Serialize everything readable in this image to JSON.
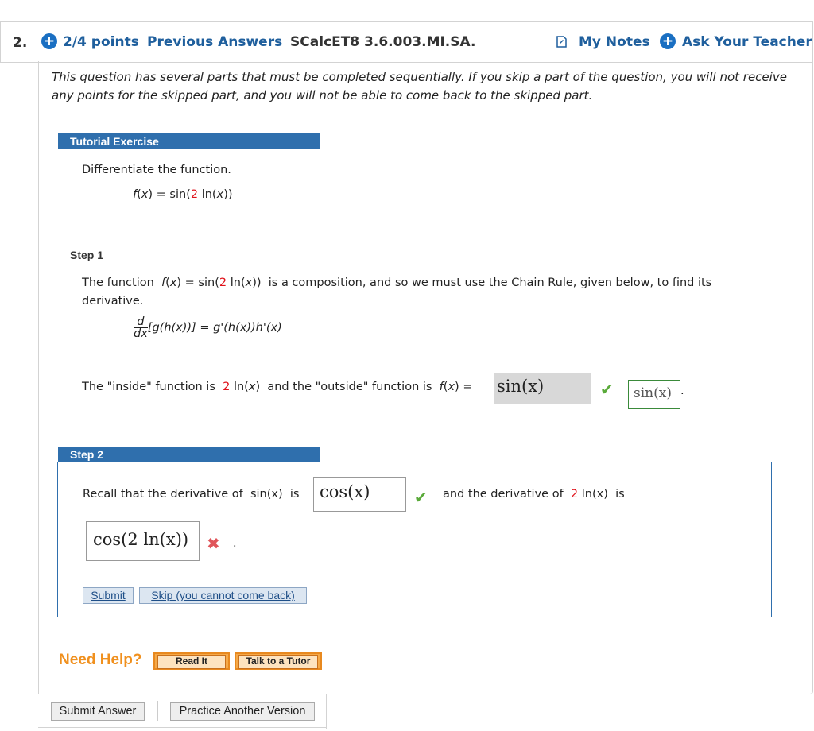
{
  "header": {
    "question_number": "2.",
    "points": "2/4 points",
    "previous_answers": "Previous Answers",
    "assignment_id": "SCalcET8 3.6.003.MI.SA.",
    "my_notes": "My Notes",
    "ask_teacher": "Ask Your Teacher"
  },
  "notice": "This question has several parts that must be completed sequentially. If you skip a part of the question, you will not receive any points for the skipped part, and you will not be able to come back to the skipped part.",
  "tutorial": {
    "title": "Tutorial Exercise",
    "instruction": "Differentiate the function.",
    "f": "f",
    "x": "x",
    "eq": "= sin(",
    "coef": "2",
    "ln": " ln(",
    "close": "))"
  },
  "step1": {
    "title": "Step 1",
    "line1_a": "The function",
    "line1_b": "is a composition, and so we must use the Chain Rule, given below, to find its",
    "line2": "derivative.",
    "d": "d",
    "dx": "dx",
    "chain_rule": "[g(h(x))] = g'(h(x))h'(x)",
    "inside_a": "The \"inside\" function is",
    "inside_b": "and the \"outside\" function is",
    "answer": "sin(x)",
    "answer_display": "sin(x)",
    "period": "."
  },
  "step2": {
    "title": "Step 2",
    "recall_a": "Recall that the derivative of",
    "sinx": "sin(x)",
    "is": "is",
    "answer1": "cos(x)",
    "recall_b": "and the derivative of",
    "two": "2",
    "lnx": "ln(x)",
    "is2": "is",
    "answer2": "cos(2 ln(x))",
    "period": ".",
    "submit": "Submit",
    "skip": "Skip (you cannot come back)"
  },
  "help": {
    "label": "Need Help?",
    "read_it": "Read It",
    "talk_tutor": "Talk to a Tutor"
  },
  "footer": {
    "submit_answer": "Submit Answer",
    "practice": "Practice Another Version"
  }
}
